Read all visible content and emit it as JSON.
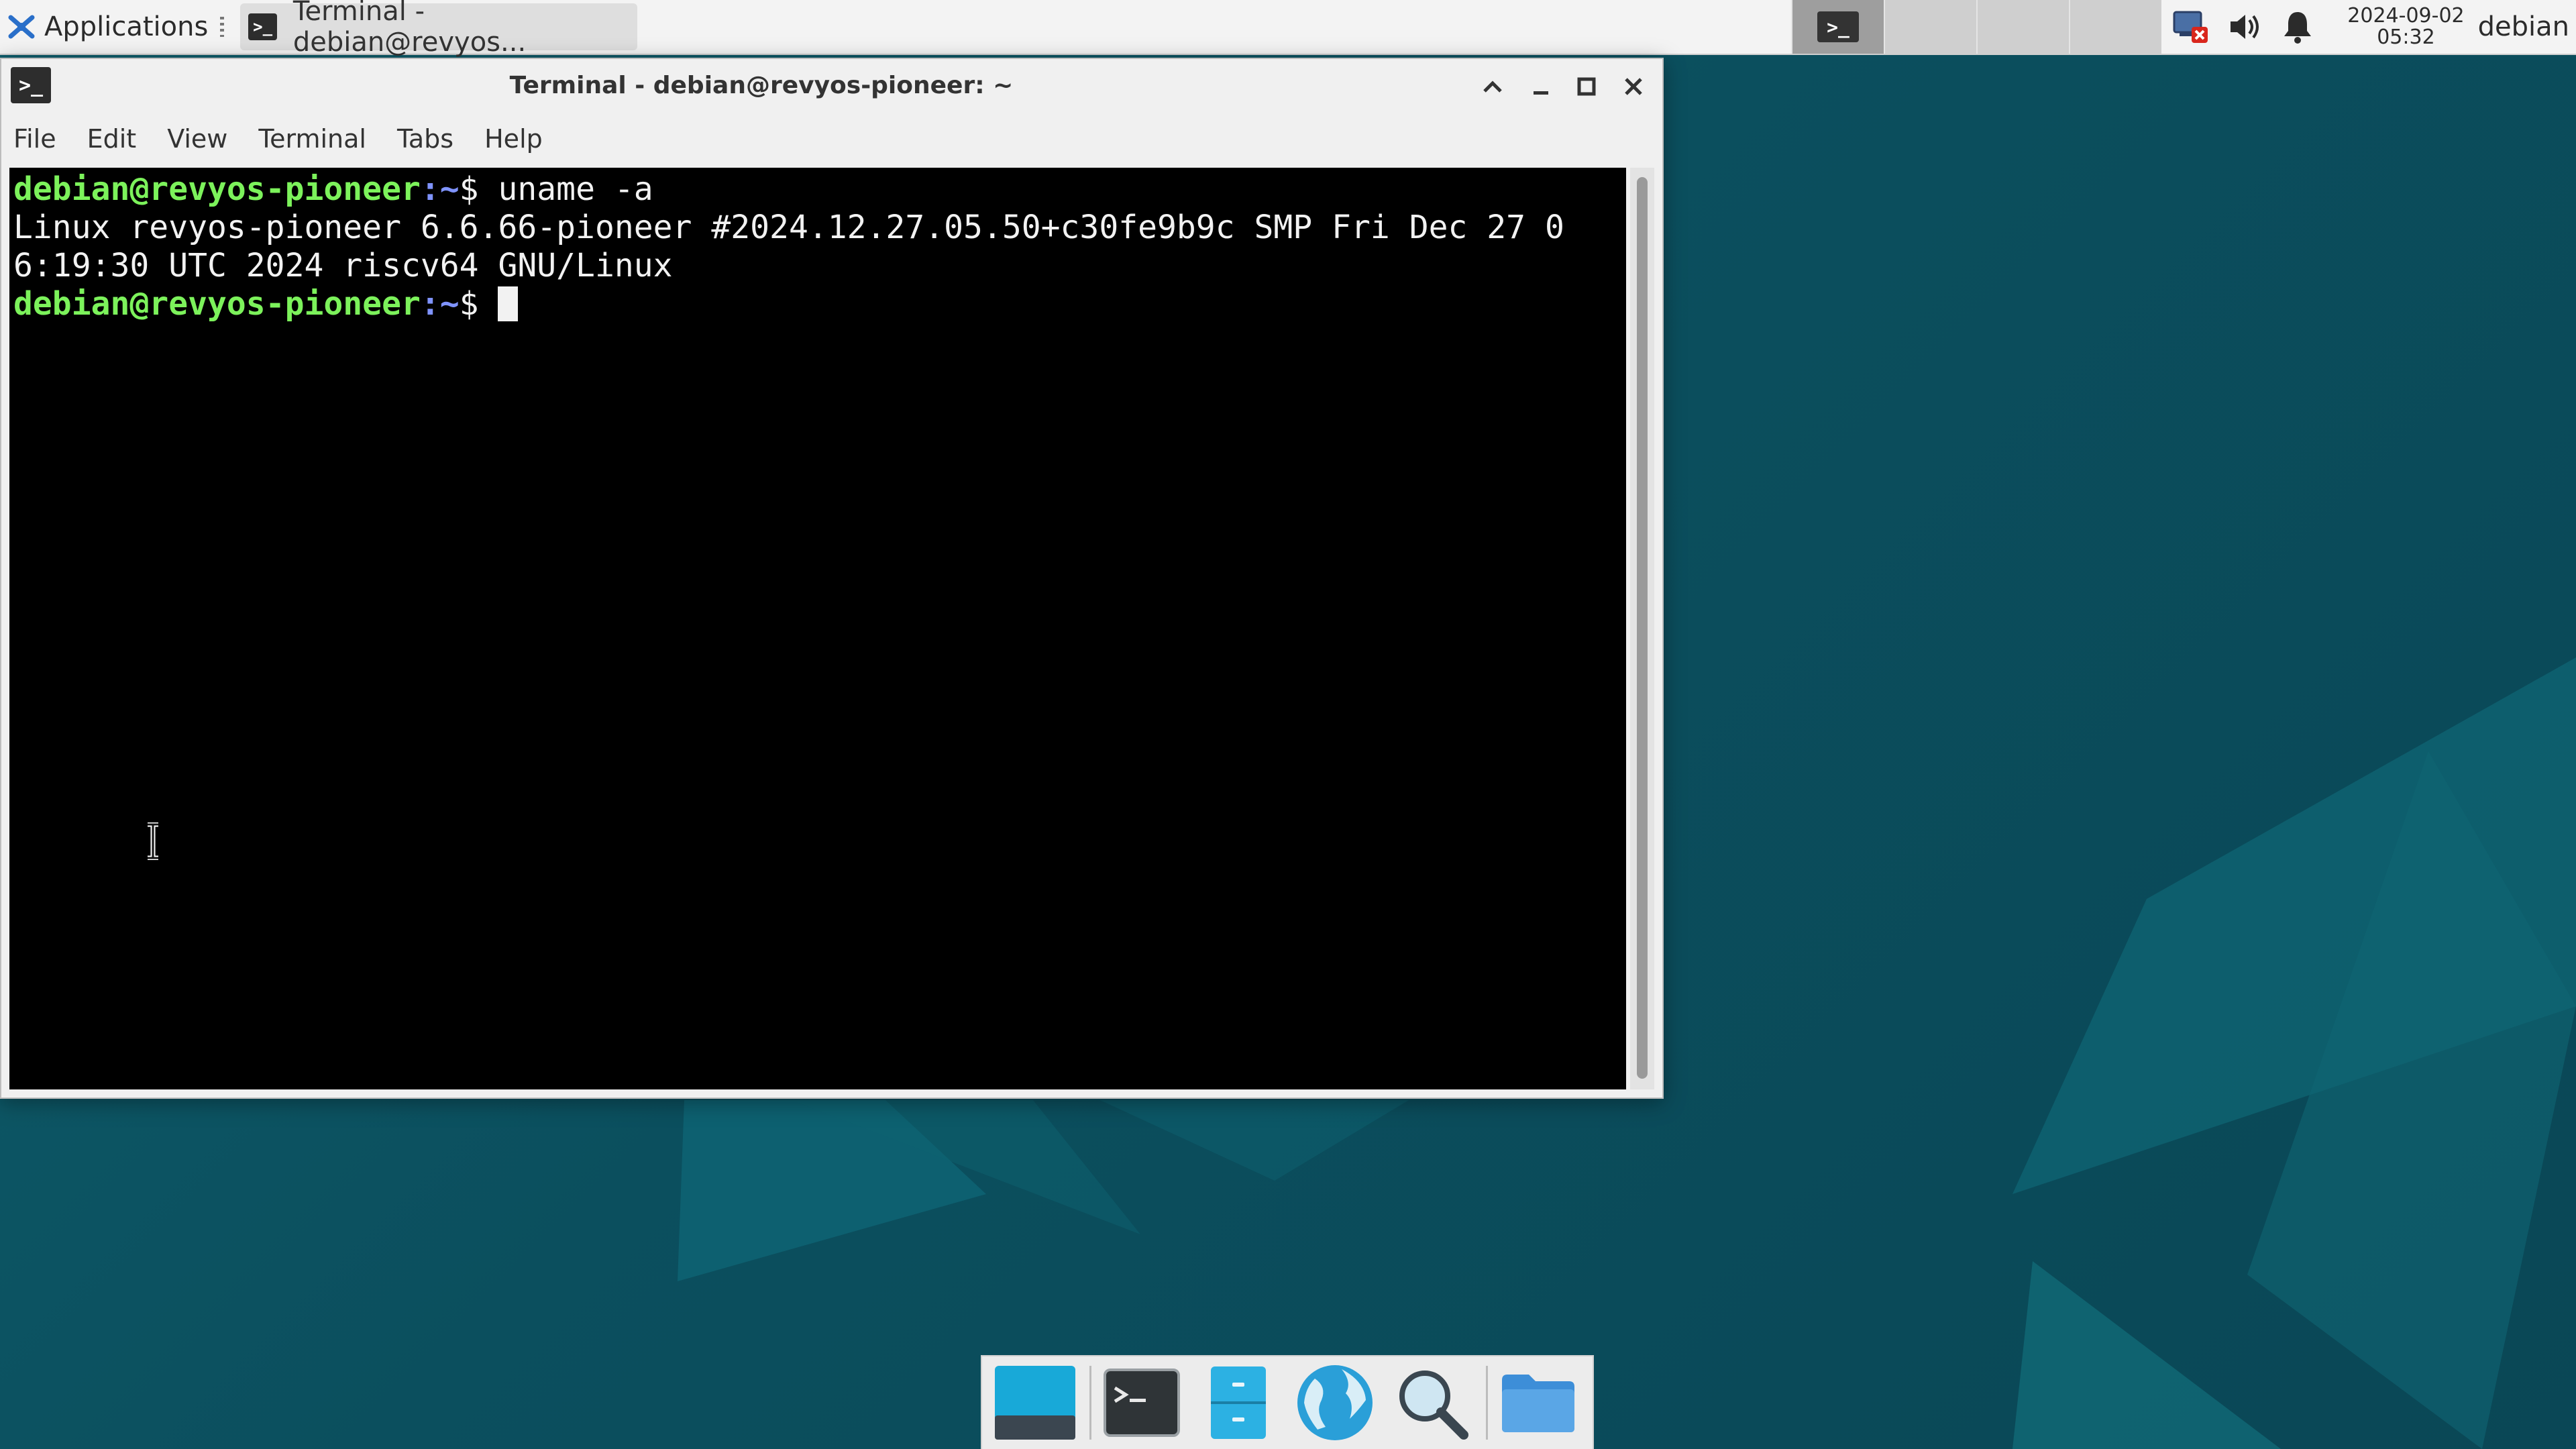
{
  "top_panel": {
    "applications_label": "Applications",
    "task_title": "Terminal - debian@revyos...",
    "clock_date": "2024-09-02",
    "clock_time": "05:32",
    "username": "debian",
    "workspace_count": 4,
    "active_workspace": 1
  },
  "terminal_window": {
    "title": "Terminal - debian@revyos-pioneer: ~",
    "menu": [
      "File",
      "Edit",
      "View",
      "Terminal",
      "Tabs",
      "Help"
    ],
    "lines": [
      {
        "prompt_user": "debian@revyos-pioneer",
        "prompt_path": ":~",
        "prompt_symbol": "$ ",
        "command": "uname -a"
      },
      {
        "output": "Linux revyos-pioneer 6.6.66-pioneer #2024.12.27.05.50+c30fe9b9c SMP Fri Dec 27 0"
      },
      {
        "output": "6:19:30 UTC 2024 riscv64 GNU/Linux"
      },
      {
        "prompt_user": "debian@revyos-pioneer",
        "prompt_path": ":~",
        "prompt_symbol": "$ ",
        "command": ""
      }
    ]
  },
  "dock": {
    "items": [
      "show-desktop",
      "terminal",
      "file-manager",
      "web-browser",
      "app-finder",
      "home-folder"
    ]
  },
  "colors": {
    "prompt_green": "#7cf25b",
    "prompt_blue": "#7f93ff",
    "desktop_teal": "#0b4f5e",
    "panel_bg": "#f3f3f3"
  }
}
